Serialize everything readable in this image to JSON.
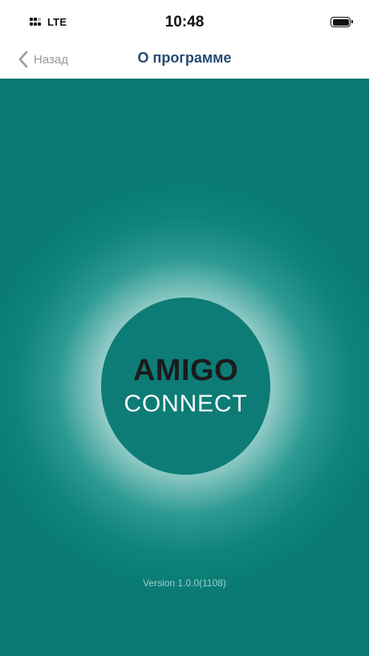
{
  "status_bar": {
    "carrier": "LTE",
    "time": "10:48"
  },
  "nav": {
    "back_label": "Назад",
    "title": "О программе"
  },
  "logo": {
    "line1": "AMIGO",
    "line2": "CONNECT"
  },
  "version": "Version 1.0.0(1108)",
  "colors": {
    "background": "#097a74",
    "logo_circle": "#0e7c76",
    "title": "#274b73",
    "back": "#9a9a9a"
  },
  "icons": [
    "signal-icon",
    "battery-icon",
    "back-chevron-icon"
  ]
}
